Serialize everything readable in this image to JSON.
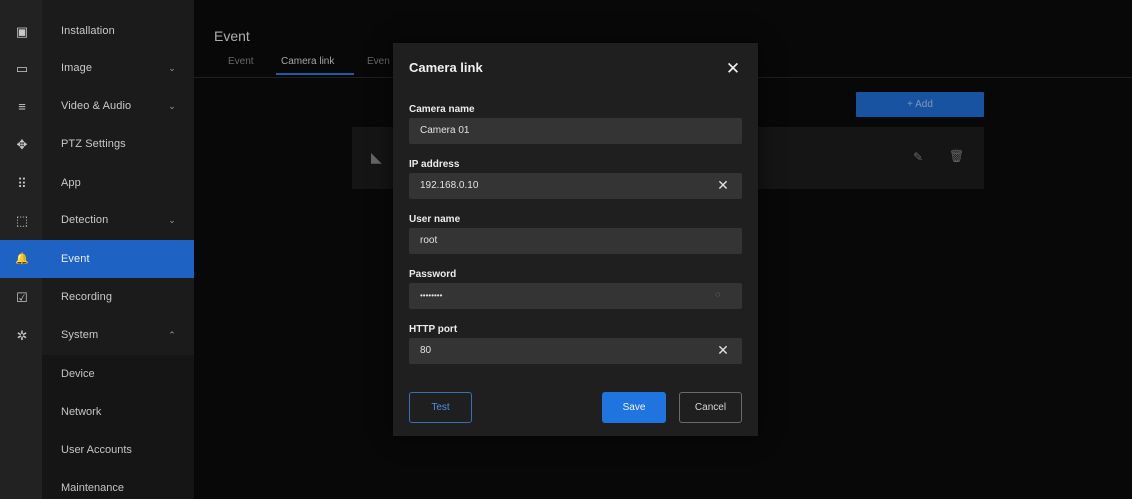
{
  "sidebar": {
    "items": [
      {
        "label": "Installation",
        "icon": "camera-icon",
        "glyph": "▣"
      },
      {
        "label": "Image",
        "icon": "image-icon",
        "glyph": "▭",
        "chevron": "⌄"
      },
      {
        "label": "Video & Audio",
        "icon": "video-audio-icon",
        "glyph": "≡",
        "chevron": "⌄"
      },
      {
        "label": "PTZ Settings",
        "icon": "ptz-icon",
        "glyph": "✥"
      },
      {
        "label": "App",
        "icon": "apps-grid-icon",
        "glyph": "⠿"
      },
      {
        "label": "Detection",
        "icon": "detection-icon",
        "glyph": "⬚",
        "chevron": "⌄"
      },
      {
        "label": "Event",
        "icon": "bell-icon",
        "glyph": "🔔"
      },
      {
        "label": "Recording",
        "icon": "recording-icon",
        "glyph": "☑"
      },
      {
        "label": "System",
        "icon": "gear-icon",
        "glyph": "✲",
        "chevron": "⌃"
      }
    ],
    "subitems": [
      "Device",
      "Network",
      "User Accounts",
      "Maintenance"
    ]
  },
  "main": {
    "title": "Event",
    "tabs": [
      "Event",
      "Camera link",
      "Even"
    ],
    "add_label": "+ Add"
  },
  "modal": {
    "title": "Camera link",
    "close": "✕",
    "fields": {
      "camera_name": {
        "label": "Camera name",
        "value": "Camera 01"
      },
      "ip_address": {
        "label": "IP address",
        "value": "192.168.0.10"
      },
      "user_name": {
        "label": "User name",
        "value": "root"
      },
      "password": {
        "label": "Password",
        "value": "••••••••"
      },
      "http_port": {
        "label": "HTTP port",
        "value": "80"
      }
    },
    "clear_glyph": "✕",
    "eye_glyph": "◌",
    "test_label": "Test",
    "save_label": "Save",
    "cancel_label": "Cancel"
  },
  "colors": {
    "accent": "#1f74e0",
    "active_nav": "#1e63c4"
  }
}
